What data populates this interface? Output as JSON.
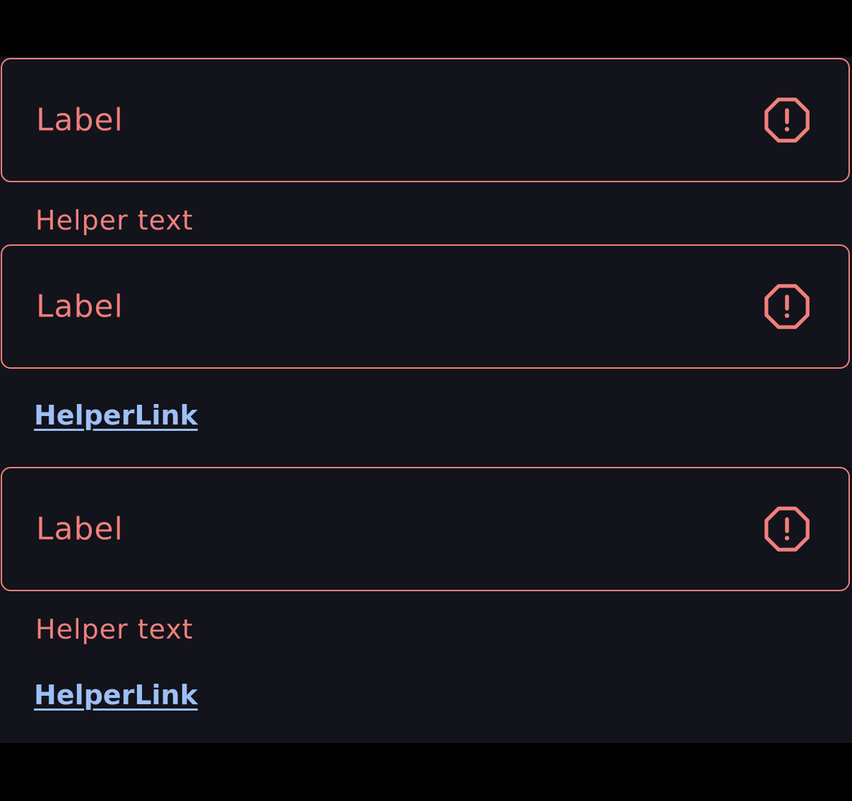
{
  "colors": {
    "error": "#f17f7c",
    "link": "#9ebff5",
    "surface": "#12131b",
    "backdrop": "#000000"
  },
  "fields": [
    {
      "label": "Label",
      "icon": "error-octagon-icon",
      "helper_text": "Helper text"
    },
    {
      "label": "Label",
      "icon": "error-octagon-icon",
      "helper_link": "HelperLink"
    },
    {
      "label": "Label",
      "icon": "error-octagon-icon",
      "helper_text": "Helper text",
      "helper_link": "HelperLink"
    }
  ]
}
